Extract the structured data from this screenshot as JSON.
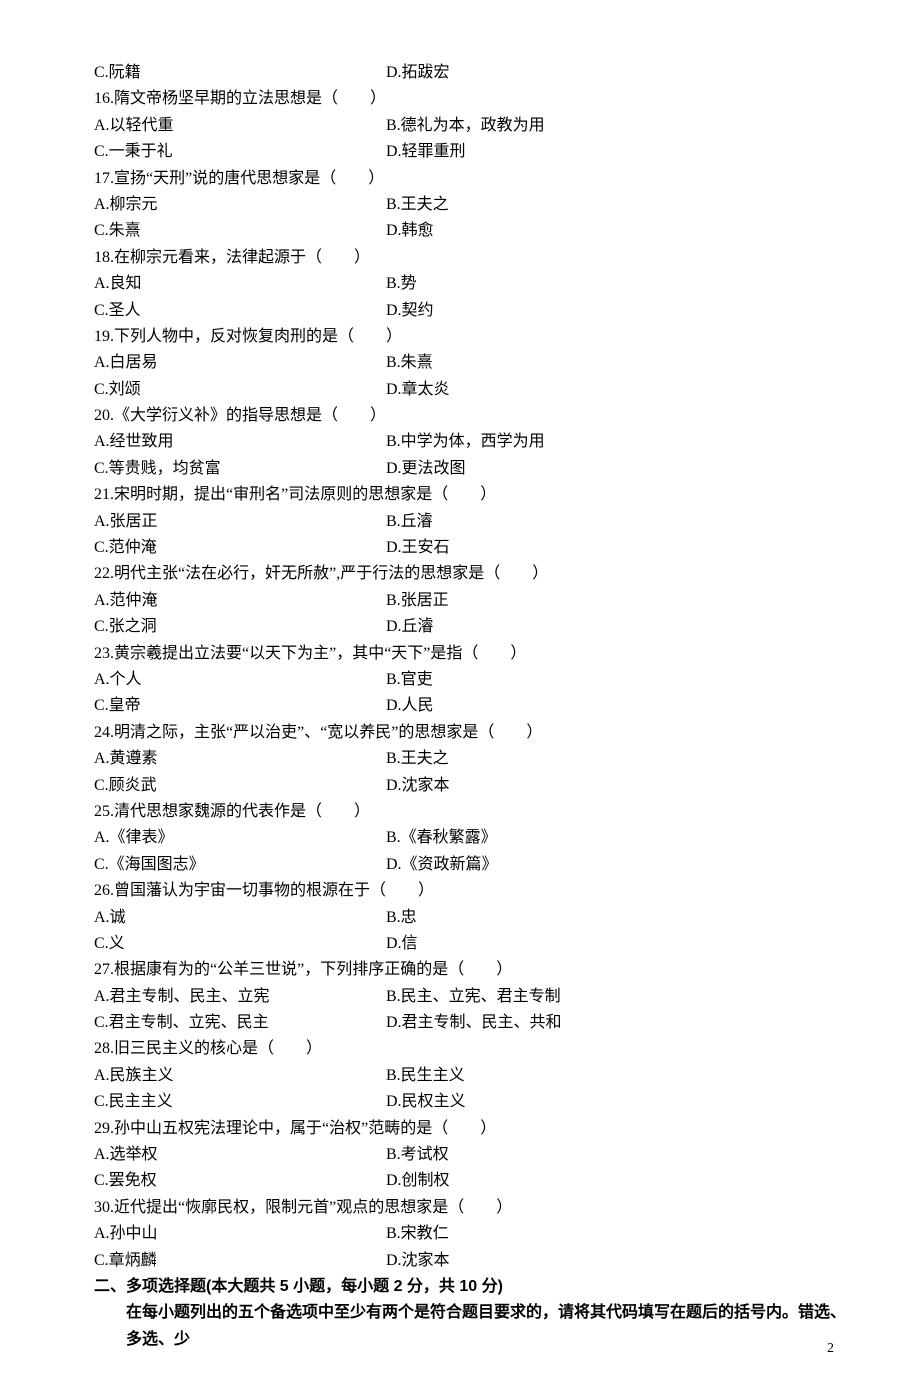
{
  "orphan_options": {
    "c": "C.阮籍",
    "d": "D.拓跋宏"
  },
  "questions": [
    {
      "stem": "16.隋文帝杨坚早期的立法思想是（　　）",
      "a": "A.以轻代重",
      "b": "B.德礼为本，政教为用",
      "c": "C.一秉于礼",
      "d": "D.轻罪重刑"
    },
    {
      "stem": "17.宣扬“天刑”说的唐代思想家是（　　）",
      "a": "A.柳宗元",
      "b": "B.王夫之",
      "c": "C.朱熹",
      "d": "D.韩愈"
    },
    {
      "stem": "18.在柳宗元看来，法律起源于（　　）",
      "a": "A.良知",
      "b": "B.势",
      "c": "C.圣人",
      "d": "D.契约"
    },
    {
      "stem": "19.下列人物中，反对恢复肉刑的是（　　）",
      "a": "A.白居易",
      "b": "B.朱熹",
      "c": "C.刘颂",
      "d": "D.章太炎"
    },
    {
      "stem": "20.《大学衍义补》的指导思想是（　　）",
      "a": "A.经世致用",
      "b": "B.中学为体，西学为用",
      "c": "C.等贵贱，均贫富",
      "d": "D.更法改图"
    },
    {
      "stem": "21.宋明时期，提出“审刑名”司法原则的思想家是（　　）",
      "a": "A.张居正",
      "b": "B.丘濬",
      "c": "C.范仲淹",
      "d": "D.王安石"
    },
    {
      "stem": "22.明代主张“法在必行，奸无所赦”,严于行法的思想家是（　　）",
      "a": "A.范仲淹",
      "b": "B.张居正",
      "c": "C.张之洞",
      "d": "D.丘濬"
    },
    {
      "stem": "23.黄宗羲提出立法要“以天下为主”，其中“天下”是指（　　）",
      "a": "A.个人",
      "b": "B.官吏",
      "c": "C.皇帝",
      "d": "D.人民"
    },
    {
      "stem": "24.明清之际，主张“严以治吏”、“宽以养民”的思想家是（　　）",
      "a": "A.黄遵素",
      "b": "B.王夫之",
      "c": "C.顾炎武",
      "d": "D.沈家本"
    },
    {
      "stem": "25.清代思想家魏源的代表作是（　　）",
      "a": "A.《律表》",
      "b": "B.《春秋繁露》",
      "c": "C.《海国图志》",
      "d": "D.《资政新篇》"
    },
    {
      "stem": "26.曾国藩认为宇宙一切事物的根源在于（　　）",
      "a": "A.诚",
      "b": "B.忠",
      "c": "C.义",
      "d": "D.信"
    },
    {
      "stem": "27.根据康有为的“公羊三世说”，下列排序正确的是（　　）",
      "a": "A.君主专制、民主、立宪",
      "b": "B.民主、立宪、君主专制",
      "c": "C.君主专制、立宪、民主",
      "d": "D.君主专制、民主、共和"
    },
    {
      "stem": "28.旧三民主义的核心是（　　）",
      "a": "A.民族主义",
      "b": "B.民生主义",
      "c": "C.民主主义",
      "d": "D.民权主义"
    },
    {
      "stem": "29.孙中山五权宪法理论中，属于“治权”范畴的是（　　）",
      "a": "A.选举权",
      "b": "B.考试权",
      "c": "C.罢免权",
      "d": "D.创制权"
    },
    {
      "stem": "30.近代提出“恢廓民权，限制元首”观点的思想家是（　　）",
      "a": "A.孙中山",
      "b": "B.宋教仁",
      "c": "C.章炳麟",
      "d": "D.沈家本"
    }
  ],
  "section2_title": "二、多项选择题(本大题共 5 小题，每小题 2 分，共 10 分)",
  "section2_sub": "在每小题列出的五个备选项中至少有两个是符合题目要求的，请将其代码填写在题后的括号内。错选、多选、少",
  "page_number": "2"
}
